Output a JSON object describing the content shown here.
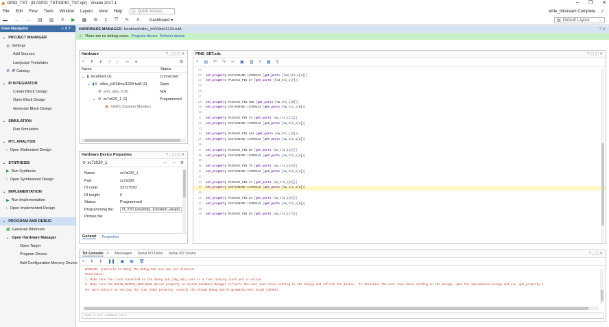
{
  "window": {
    "title": "GPIO_TST - [D:/GPIO_TST/GPIO_TST.xpr] - Vivado 2017.1",
    "controls": [
      "–",
      "❐",
      "✕"
    ]
  },
  "menu": {
    "items": [
      "File",
      "Edit",
      "Flow",
      "Tools",
      "Window",
      "Layout",
      "View",
      "Help"
    ],
    "quick_access_placeholder": "Q- Quick Access",
    "status": "write_bitstream Complete"
  },
  "toolbar": {
    "dashboard": "Dashboard ▾",
    "layout": "Default Layout"
  },
  "flow_navigator": {
    "title": "Flow Navigator",
    "controls": "≡  ⇕  ?  _",
    "items": [
      {
        "type": "section",
        "label": "PROJECT MANAGER",
        "chev": "⌄"
      },
      {
        "type": "icon",
        "label": "Settings",
        "icon": "⚙"
      },
      {
        "type": "sub",
        "label": "Add Sources"
      },
      {
        "type": "sub",
        "label": "Language Templates"
      },
      {
        "type": "icon",
        "label": "IP Catalog",
        "icon": "⚙"
      },
      {
        "type": "gap"
      },
      {
        "type": "section",
        "label": "IP INTEGRATOR",
        "chev": "⌄"
      },
      {
        "type": "sub",
        "label": "Create Block Design"
      },
      {
        "type": "sub",
        "label": "Open Block Design"
      },
      {
        "type": "sub",
        "label": "Generate Block Design"
      },
      {
        "type": "gap"
      },
      {
        "type": "section",
        "label": "SIMULATION",
        "chev": "⌄"
      },
      {
        "type": "sub",
        "label": "Run Simulation"
      },
      {
        "type": "gap"
      },
      {
        "type": "section",
        "label": "RTL ANALYSIS",
        "chev": "⌄"
      },
      {
        "type": "sub2",
        "label": "Open Elaborated Design",
        "chev": "›"
      },
      {
        "type": "gap"
      },
      {
        "type": "section",
        "label": "SYNTHESIS",
        "chev": "⌄"
      },
      {
        "type": "run",
        "label": "Run Synthesis",
        "icon": "▶"
      },
      {
        "type": "sub2",
        "label": "Open Synthesized Design",
        "chev": "›"
      },
      {
        "type": "gap"
      },
      {
        "type": "section",
        "label": "IMPLEMENTATION",
        "chev": "⌄"
      },
      {
        "type": "run",
        "label": "Run Implementation",
        "icon": "▶"
      },
      {
        "type": "sub2",
        "label": "Open Implemented Design",
        "chev": "›"
      },
      {
        "type": "gap"
      },
      {
        "type": "section-sel",
        "label": "PROGRAM AND DEBUG",
        "chev": "⌄"
      },
      {
        "type": "run",
        "label": "Generate Bitstream",
        "icon": "▦"
      },
      {
        "type": "sub2b",
        "label": "Open Hardware Manager",
        "chev": "⌄"
      },
      {
        "type": "sub3",
        "label": "Open Target"
      },
      {
        "type": "sub3",
        "label": "Program Device"
      },
      {
        "type": "sub3",
        "label": "Add Configuration Memory Device"
      }
    ]
  },
  "hardware_manager": {
    "title": "HARDWARE MANAGER",
    "path": " - localhost/xilinx_tcf/Xilinx/1234-tulA",
    "notice": "There are no debug cores.",
    "program_link": "Program device",
    "refresh_link": "Refresh device"
  },
  "hardware_panel": {
    "title": "Hardware",
    "col_name": "Name",
    "col_status": "Status",
    "rows": [
      {
        "indent": 3,
        "chev": "⌄",
        "icon": "▮",
        "name": "localhost (1)",
        "status": "Connected"
      },
      {
        "indent": 11,
        "chev": "⌄",
        "icon": "▮⚙",
        "name": "xilinx_tcf/Xilinx/1234-tulA (2)",
        "status": "Open"
      },
      {
        "indent": 27,
        "chev": "",
        "icon": "⚙",
        "name": "arm_dap_0 (0)",
        "status": "N/A"
      },
      {
        "indent": 19,
        "chev": "⌄",
        "icon": "⚙",
        "name": "xc7z020_1 (1)",
        "status": "Programmed"
      },
      {
        "indent": 37,
        "chev": "",
        "icon": "▦",
        "name": "XADC (System Monitor)",
        "status": ""
      }
    ]
  },
  "device_props": {
    "title": "Hardware Device Properties",
    "device": "xc7z020_1",
    "rows": [
      {
        "k": "Name:",
        "v": "xc7z020_1"
      },
      {
        "k": "Part:",
        "v": "xc7z020"
      },
      {
        "k": "ID code:",
        "v": "23727093"
      },
      {
        "k": "IR length:",
        "v": "6"
      },
      {
        "k": "Status:",
        "v": "Programmed"
      },
      {
        "k": "Programming file:",
        "v": "O_TST.runs/impl_1/system_wrapp"
      },
      {
        "k": "Probes file:",
        "v": ""
      }
    ],
    "tabs": [
      "General",
      "Properties"
    ]
  },
  "editor": {
    "title": "PINS_SET.xdc",
    "lines": [
      {
        "n": "22",
        "t": ""
      },
      {
        "n": "23",
        "p": "IOSTANDARD LVCMOS33",
        "port": "led_tri_o[7]"
      },
      {
        "n": "24",
        "p": "PACKAGE_PIN U7",
        "port": "led_tri_o[7]"
      },
      {
        "n": "25",
        "t": ""
      },
      {
        "n": "26",
        "t": ""
      },
      {
        "n": "27",
        "t": ""
      },
      {
        "n": "28",
        "p": "PACKAGE_PIN AB6",
        "port": "sw_tri_i[0]"
      },
      {
        "n": "29",
        "p": "IOSTANDARD LVCMOS33",
        "port": "sw_tri_i[0]"
      },
      {
        "n": "30",
        "t": ""
      },
      {
        "n": "31",
        "p": "PACKAGE_PIN Y4",
        "port": "sw_tri_i[1]"
      },
      {
        "n": "32",
        "p": "IOSTANDARD LVCMOS33",
        "port": "sw_tri_i[1]"
      },
      {
        "n": "33",
        "t": ""
      },
      {
        "n": "34",
        "p": "PACKAGE_PIN AA4",
        "port": "sw_tri_i[2]"
      },
      {
        "n": "35",
        "p": "IOSTANDARD LVCMOS33",
        "port": "sw_tri_i[2]"
      },
      {
        "n": "36",
        "t": ""
      },
      {
        "n": "37",
        "p": "PACKAGE_PIN R6",
        "port": "sw_tri_i[3]"
      },
      {
        "n": "38",
        "p": "IOSTANDARD LVCMOS33",
        "port": "sw_tri_i[3]"
      },
      {
        "n": "39",
        "t": ""
      },
      {
        "n": "40",
        "p": "PACKAGE_PIN T6",
        "port": "sw_tri_i[4]"
      },
      {
        "n": "41",
        "p": "IOSTANDARD LVCMOS33",
        "port": "sw_tri_i[4]"
      },
      {
        "n": "42",
        "t": ""
      },
      {
        "n": "43",
        "p": "PACKAGE_PIN T4",
        "port": "sw_tri_i[5]"
      },
      {
        "n": "44",
        "p": "IOSTANDARD LVCMOS33",
        "port": "sw_tri_i[5]",
        "hl": true
      },
      {
        "n": "45",
        "t": ""
      },
      {
        "n": "46",
        "p": "PACKAGE_PIN U4",
        "port": "sw_tri_i[6]"
      },
      {
        "n": "47",
        "p": "IOSTANDARD LVCMOS33",
        "port": "sw_tri_i[6]"
      },
      {
        "n": "48",
        "t": ""
      },
      {
        "n": "49",
        "p": "PACKAGE_PIN V5",
        "port": "sw_tri_i[7]"
      }
    ]
  },
  "tcl": {
    "tabs": [
      "Tcl Console",
      "Messages",
      "Serial I/O Links",
      "Serial I/O Scans"
    ],
    "lines": [
      {
        "c": "#c0392b",
        "t": "WARNING: [Labtools 27-3361] The debug hub core was not detected."
      },
      {
        "c": "#c0392b",
        "t": "Resolution:"
      },
      {
        "c": "#c0392b",
        "t": "1. Make sure the clock connected to the debug hub (dbg_hub) core is a free running clock and is active."
      },
      {
        "c": "#c0392b",
        "t": "2. Make sure the BSCAN_SWITCH_USER_MASK device property in Vivado Hardware Manager reflects the user scan chain setting in the design and refresh the device.  To determine the user scan chain setting in the design, open the implemented design and use 'get_property C"
      },
      {
        "c": "#c0392b",
        "t": "For more details on setting the scan chain property, consult the Vivado Debug and Programming User Guide (UG908)."
      }
    ],
    "input_placeholder": "Type a Tcl command here"
  }
}
